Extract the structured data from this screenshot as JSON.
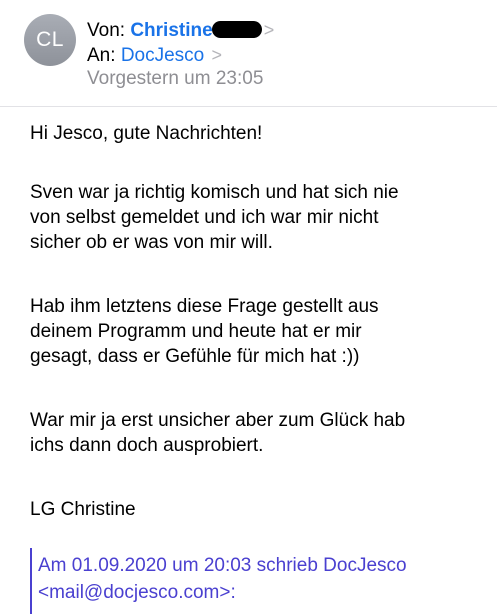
{
  "header": {
    "avatar_initials": "CL",
    "from_label": "Von:",
    "sender_name": "Christine",
    "to_label": "An:",
    "recipient_name": "DocJesco",
    "chevron": ">",
    "date": "Vorgestern um 23:05"
  },
  "message": {
    "paragraphs": [
      "Hi Jesco, gute Nachrichten!",
      "Sven war ja richtig komisch und hat sich nie\nvon selbst gemeldet und ich war mir nicht\nsicher ob er was von mir will.",
      "Hab ihm letztens diese Frage gestellt aus\ndeinem Programm und heute hat er mir\ngesagt, dass er Gefühle für mich hat :))",
      "War mir ja erst unsicher aber zum Glück hab\nichs dann doch ausprobiert.",
      "LG Christine"
    ],
    "quote_header": "Am 01.09.2020 um 20:03 schrieb DocJesco\n<mail@docjesco.com>:"
  },
  "colors": {
    "link": "#1a73e8",
    "quote": "#4a40d0",
    "secondary": "#8e8e93",
    "avatar": "#9a9ea6"
  },
  "icons": {
    "chevron": "chevron-right-icon",
    "redaction": "redaction-bar"
  }
}
